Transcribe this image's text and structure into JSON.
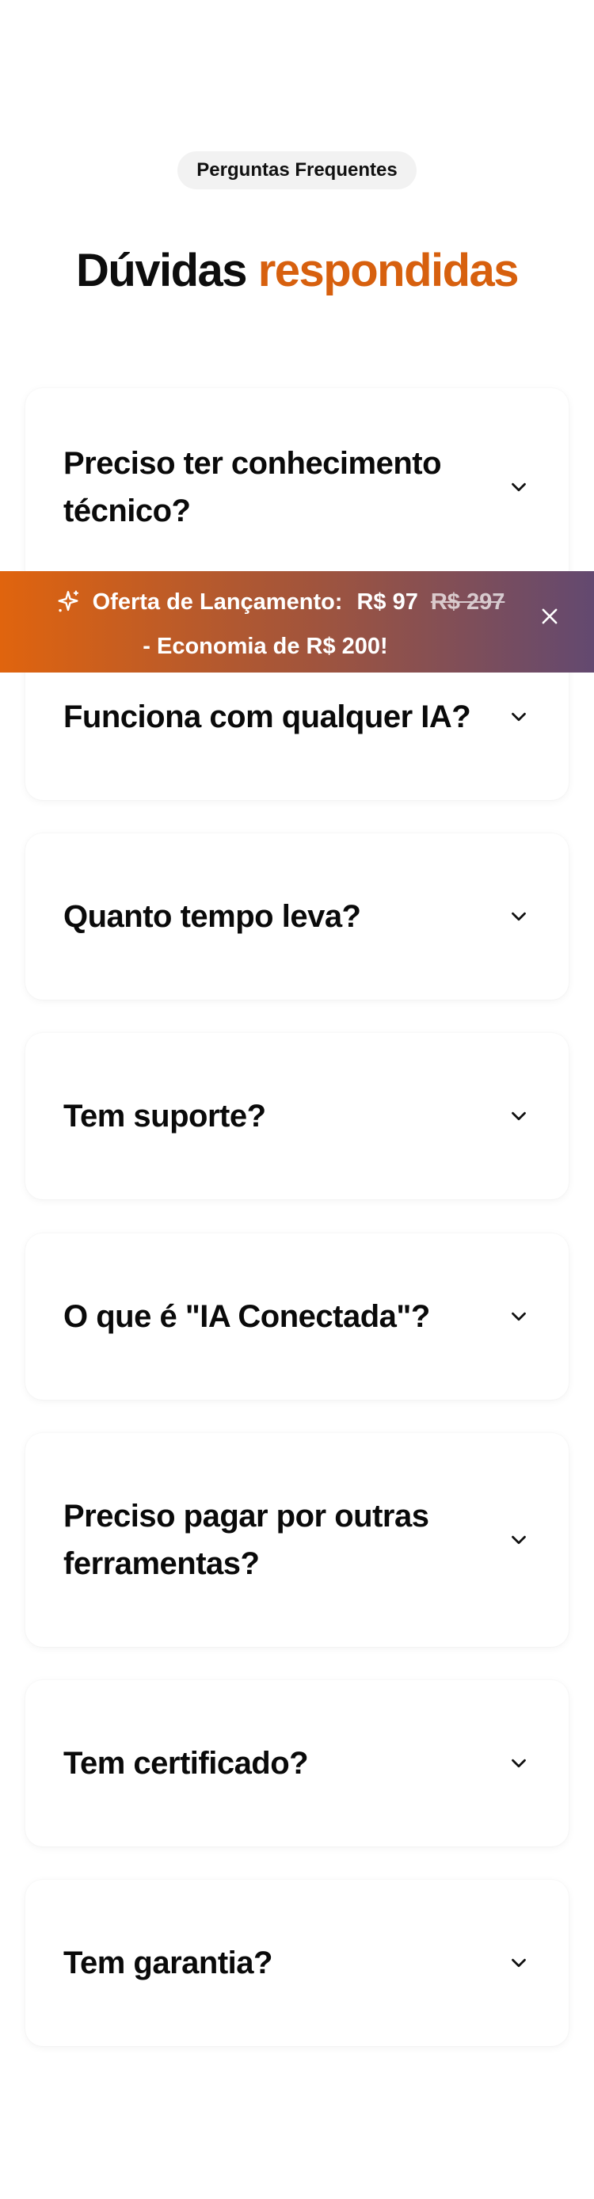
{
  "header": {
    "badge": "Perguntas Frequentes",
    "title_plain": "Dúvidas",
    "title_accent": "respondidas"
  },
  "faq": {
    "items": [
      {
        "question": "Preciso ter conhecimento técnico?"
      },
      {
        "question": "Funciona com qualquer IA?"
      },
      {
        "question": "Quanto tempo leva?"
      },
      {
        "question": "Tem suporte?"
      },
      {
        "question": "O que é \"IA Conectada\"?"
      },
      {
        "question": "Preciso pagar por outras ferramentas?"
      },
      {
        "question": "Tem certificado?"
      },
      {
        "question": "Tem garantia?"
      }
    ]
  },
  "banner": {
    "label": "Oferta de Lançamento:",
    "price": "R$ 97",
    "old_price": "R$ 297",
    "savings": "- Economia de R$ 200!"
  },
  "colors": {
    "accent": "#d7600e",
    "banner_start": "#e0640e",
    "banner_end": "#634970"
  },
  "icons": {
    "chevron": "chevron-down-icon",
    "sparkle": "sparkle-icon",
    "close": "close-icon"
  }
}
